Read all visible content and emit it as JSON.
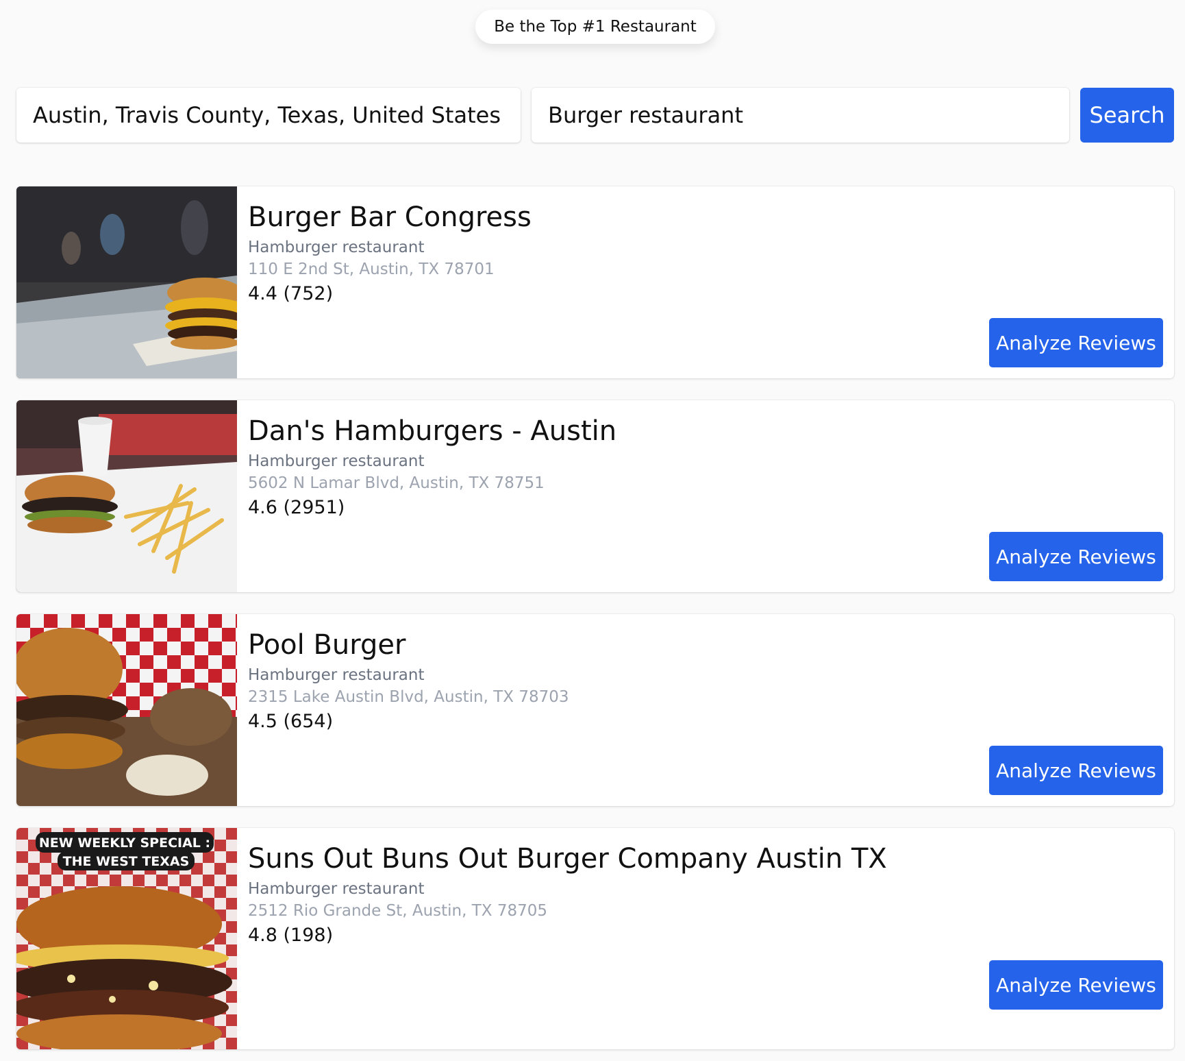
{
  "header": {
    "badge_text": "Be the Top #1 Restaurant"
  },
  "search": {
    "location_value": "Austin, Travis County, Texas, United States",
    "keyword_value": "Burger restaurant",
    "button_label": "Search"
  },
  "results": [
    {
      "name": "Burger Bar Congress",
      "category": "Hamburger restaurant",
      "address": "110 E 2nd St, Austin, TX 78701",
      "rating": "4.4 (752)",
      "button_label": "Analyze Reviews"
    },
    {
      "name": "Dan's Hamburgers - Austin",
      "category": "Hamburger restaurant",
      "address": "5602 N Lamar Blvd, Austin, TX 78751",
      "rating": "4.6 (2951)",
      "button_label": "Analyze Reviews"
    },
    {
      "name": "Pool Burger",
      "category": "Hamburger restaurant",
      "address": "2315 Lake Austin Blvd, Austin, TX 78703",
      "rating": "4.5 (654)",
      "button_label": "Analyze Reviews"
    },
    {
      "name": "Suns Out Buns Out Burger Company Austin TX",
      "category": "Hamburger restaurant",
      "address": "2512 Rio Grande St, Austin, TX 78705",
      "rating": "4.8 (198)",
      "button_label": "Analyze Reviews",
      "photo_overlay_text": [
        "NEW WEEKLY SPECIAL :",
        "THE WEST TEXAS"
      ]
    }
  ],
  "colors": {
    "accent": "#2563eb",
    "muted": "#6b7280",
    "faint": "#9ca3af"
  }
}
